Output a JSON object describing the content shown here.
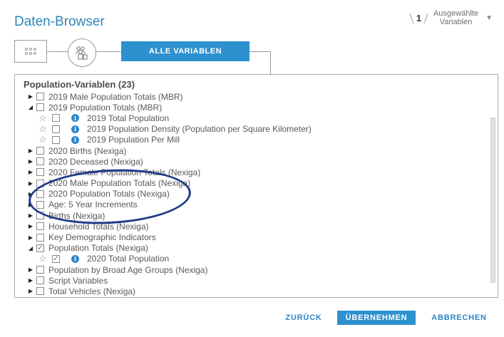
{
  "header": {
    "title": "Daten-Browser",
    "selected_count": "1",
    "selected_label_line1": "Ausgewählte",
    "selected_label_line2": "Variablen"
  },
  "nav": {
    "all_variables_label": "ALLE VARIABLEN"
  },
  "panel": {
    "title": "Population-Variablen (23)",
    "rows": [
      {
        "type": "group",
        "expanded": false,
        "checked": false,
        "label": "2019 Male Population Totals (MBR)"
      },
      {
        "type": "group",
        "expanded": true,
        "checked": false,
        "label": "2019 Population Totals (MBR)"
      },
      {
        "type": "item",
        "checked": false,
        "label": "2019 Total Population"
      },
      {
        "type": "item",
        "checked": false,
        "label": "2019 Population Density (Population per Square Kilometer)"
      },
      {
        "type": "item",
        "checked": false,
        "label": "2019 Population Per Mill"
      },
      {
        "type": "group",
        "expanded": false,
        "checked": false,
        "label": "2020 Births (Nexiga)"
      },
      {
        "type": "group",
        "expanded": false,
        "checked": false,
        "label": "2020 Deceased (Nexiga)"
      },
      {
        "type": "group",
        "expanded": false,
        "checked": false,
        "label": "2020 Female Population Totals (Nexiga)"
      },
      {
        "type": "group",
        "expanded": false,
        "checked": false,
        "label": "2020 Male Population Totals (Nexiga)"
      },
      {
        "type": "group",
        "expanded": false,
        "checked": false,
        "label": "2020 Population Totals (Nexiga)"
      },
      {
        "type": "group",
        "expanded": false,
        "checked": false,
        "label": "Age: 5 Year Increments"
      },
      {
        "type": "group",
        "expanded": false,
        "checked": false,
        "label": "Births (Nexiga)"
      },
      {
        "type": "group",
        "expanded": false,
        "checked": false,
        "label": "Household Totals (Nexiga)"
      },
      {
        "type": "group",
        "expanded": false,
        "checked": false,
        "label": "Key Demographic Indicators"
      },
      {
        "type": "group",
        "expanded": true,
        "checked": true,
        "label": "Population Totals (Nexiga)"
      },
      {
        "type": "item",
        "checked": true,
        "label": "2020 Total Population"
      },
      {
        "type": "group",
        "expanded": false,
        "checked": false,
        "label": "Population by Broad Age Groups (Nexiga)"
      },
      {
        "type": "group",
        "expanded": false,
        "checked": false,
        "label": "Script Variables"
      },
      {
        "type": "group",
        "expanded": false,
        "checked": false,
        "label": "Total Vehicles (Nexiga)"
      }
    ]
  },
  "footer": {
    "back_label": "ZURÜCK",
    "apply_label": "ÜBERNEHMEN",
    "cancel_label": "ABBRECHEN"
  },
  "colors": {
    "accent": "#2d91cf",
    "title": "#2d86b7",
    "annotation_ellipse": "#1f3a8a"
  }
}
